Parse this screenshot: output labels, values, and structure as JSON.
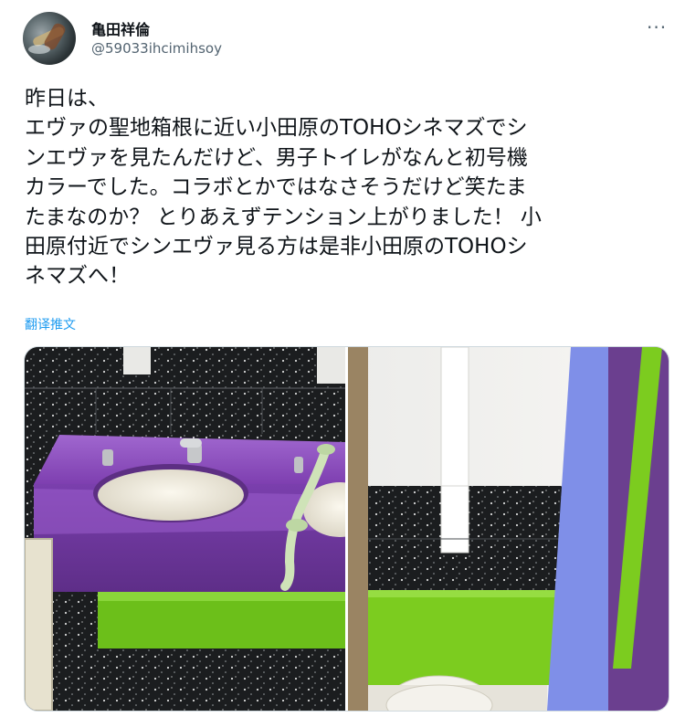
{
  "user": {
    "display_name": "亀田祥倫",
    "handle": "@59033ihcimihsoy"
  },
  "menu": {
    "more_glyph": "···"
  },
  "tweet": {
    "lines": [
      "昨日は、",
      "エヴァの聖地箱根に近い小田原のTOHOシネマズでシ",
      "ンエヴァを見たんだけど、男子トイレがなんと初号機",
      "カラーでした。コラボとかではなさそうだけど笑たま",
      "たまなのか？ とりあえずテンション上がりました！ 小",
      "田原付近でシンエヴァ見る方は是非小田原のTOHOシ",
      "ネマズへ！"
    ],
    "translate_label": "翻译推文"
  },
  "colors": {
    "purple": "#8a4bb8",
    "green": "#7ccc1f",
    "blue": "#7f8fe8",
    "handrail": "#cfe3b8",
    "link": "#1d9bf0"
  }
}
